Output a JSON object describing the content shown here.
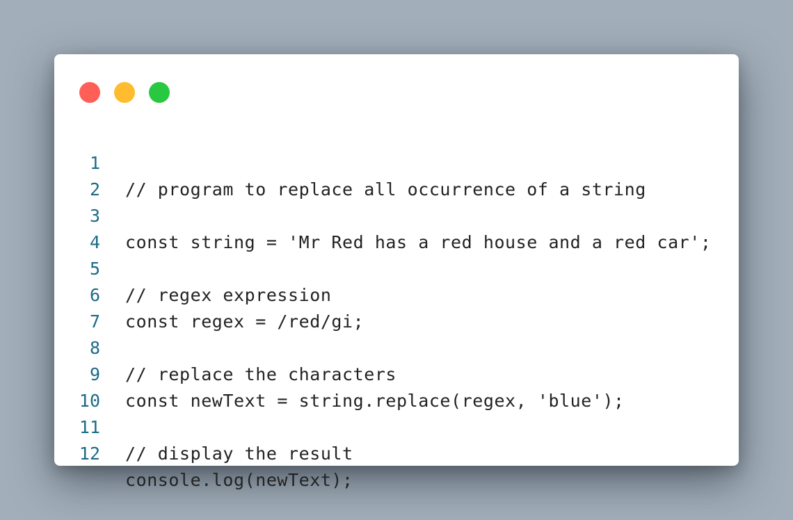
{
  "window": {
    "controls": [
      {
        "name": "close",
        "color": "#ff5f57"
      },
      {
        "name": "minimize",
        "color": "#febc2e"
      },
      {
        "name": "maximize",
        "color": "#28c840"
      }
    ]
  },
  "colors": {
    "background": "#a2aeb9",
    "window_background": "#ffffff",
    "line_number": "#1d6a86",
    "code_text": "#222222"
  },
  "code": {
    "lines": [
      {
        "number": "1",
        "text": "// program to replace all occurrence of a string"
      },
      {
        "number": "2",
        "text": ""
      },
      {
        "number": "3",
        "text": "const string = 'Mr Red has a red house and a red car';"
      },
      {
        "number": "4",
        "text": ""
      },
      {
        "number": "5",
        "text": "// regex expression"
      },
      {
        "number": "6",
        "text": "const regex = /red/gi;"
      },
      {
        "number": "7",
        "text": ""
      },
      {
        "number": "8",
        "text": "// replace the characters"
      },
      {
        "number": "9",
        "text": "const newText = string.replace(regex, 'blue');"
      },
      {
        "number": "10",
        "text": ""
      },
      {
        "number": "11",
        "text": "// display the result"
      },
      {
        "number": "12",
        "text": "console.log(newText);"
      }
    ]
  }
}
